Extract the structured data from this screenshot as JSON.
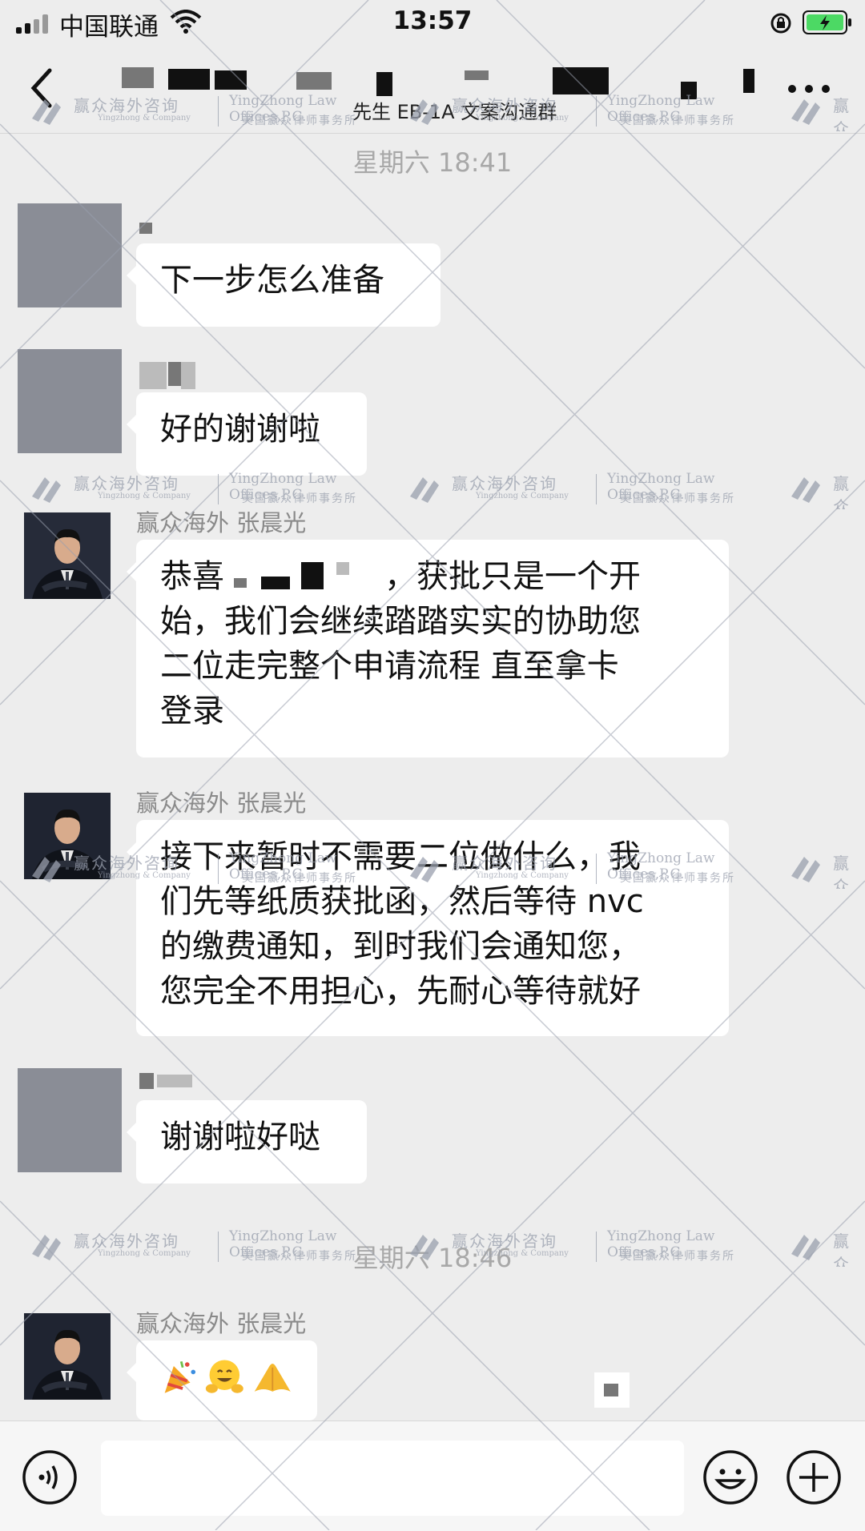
{
  "status_bar": {
    "carrier": "中国联通",
    "time": "13:57"
  },
  "nav": {
    "title_visible": "先生 EB-1A 文案沟通群"
  },
  "timestamps": [
    "星期六 18:41",
    "星期六 18:46"
  ],
  "messages": [
    {
      "sender": "",
      "text": "下一步怎么准备"
    },
    {
      "sender": "",
      "text": "好的谢谢啦"
    },
    {
      "sender": "赢众海外 张晨光",
      "lines": [
        "恭喜",
        "，获批只是一个开",
        "始，我们会继续踏踏实实的协助您",
        "二位走完整个申请流程 直至拿卡",
        "登录"
      ]
    },
    {
      "sender": "赢众海外 张晨光",
      "lines": [
        "接下来暂时不需要二位做什么，我",
        "们先等纸质获批函，然后等待 nvc",
        "的缴费通知，到时我们会通知您，",
        "您完全不用担心，先耐心等待就好"
      ]
    },
    {
      "sender": "",
      "text": "谢谢啦好哒"
    },
    {
      "sender": "赢众海外 张晨光",
      "emojis": [
        "party-popper-icon",
        "hugging-face-icon",
        "raised-hands-icon"
      ]
    }
  ],
  "watermark": {
    "cn": "赢众海外咨询",
    "cn_sub": "Yingzhong & Company",
    "en": "YingZhong Law Offices,P.C.",
    "en_sub": "美国赢众律师事务所"
  },
  "colors": {
    "background": "#ededed",
    "bubble": "#ffffff",
    "timestamp": "#a8a8a8",
    "sender": "#8a8a8a",
    "battery_green": "#4cd964"
  }
}
